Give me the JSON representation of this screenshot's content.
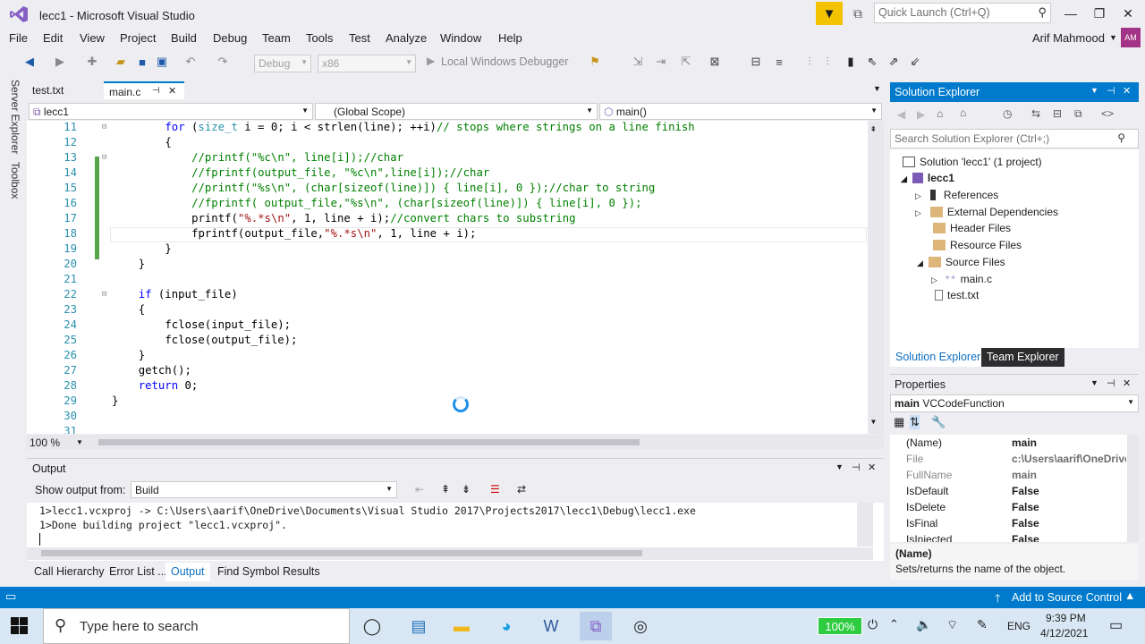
{
  "window": {
    "title": "lecc1 - Microsoft Visual Studio",
    "quick_launch_placeholder": "Quick Launch (Ctrl+Q)"
  },
  "menu": [
    "File",
    "Edit",
    "View",
    "Project",
    "Build",
    "Debug",
    "Team",
    "Tools",
    "Test",
    "Analyze",
    "Window",
    "Help"
  ],
  "user": {
    "name": "Arif Mahmood",
    "initials": "AM"
  },
  "toolbar": {
    "config": "Debug",
    "platform": "x86",
    "debugger": "Local Windows Debugger"
  },
  "editor": {
    "tabs": [
      {
        "label": "test.txt"
      },
      {
        "label": "main.c"
      }
    ],
    "nav": {
      "project": "lecc1",
      "scope": "(Global Scope)",
      "function": "main()"
    },
    "zoom": "100 %",
    "lines": [
      {
        "n": "11",
        "segments": [
          {
            "c": "kw",
            "t": "for"
          },
          {
            "c": "",
            "t": " ("
          },
          {
            "c": "ty",
            "t": "size_t"
          },
          {
            "c": "",
            "t": " i = 0; i < strlen(line); ++i)"
          },
          {
            "c": "cm",
            "t": "// stops where strings on a line finish"
          }
        ],
        "indent": 4
      },
      {
        "n": "12",
        "segments": [
          {
            "c": "",
            "t": "{"
          }
        ],
        "indent": 4
      },
      {
        "n": "13",
        "segments": [
          {
            "c": "cm",
            "t": "//printf(\"%c\\n\", line[i]);//char"
          }
        ],
        "indent": 5
      },
      {
        "n": "14",
        "segments": [
          {
            "c": "cm",
            "t": "//fprintf(output_file, \"%c\\n\",line[i]);//char"
          }
        ],
        "indent": 5
      },
      {
        "n": "15",
        "segments": [
          {
            "c": "cm",
            "t": "//printf(\"%s\\n\", (char[sizeof(line)]) { line[i], 0 });//char to string"
          }
        ],
        "indent": 5
      },
      {
        "n": "16",
        "segments": [
          {
            "c": "cm",
            "t": "//fprintf( output_file,\"%s\\n\", (char[sizeof(line)]) { line[i], 0 });"
          }
        ],
        "indent": 5
      },
      {
        "n": "17",
        "segments": [
          {
            "c": "",
            "t": "printf("
          },
          {
            "c": "st",
            "t": "\"%.*s\\n\""
          },
          {
            "c": "",
            "t": ", 1, line + i);"
          },
          {
            "c": "cm",
            "t": "//convert chars to substring"
          }
        ],
        "indent": 5
      },
      {
        "n": "18",
        "segments": [
          {
            "c": "",
            "t": "fprintf(output_file,"
          },
          {
            "c": "st",
            "t": "\"%.*s\\n\""
          },
          {
            "c": "",
            "t": ", 1, line + i);"
          }
        ],
        "indent": 5
      },
      {
        "n": "19",
        "segments": [
          {
            "c": "",
            "t": "}"
          }
        ],
        "indent": 4
      },
      {
        "n": "20",
        "segments": [
          {
            "c": "",
            "t": "}"
          }
        ],
        "indent": 3
      },
      {
        "n": "21",
        "segments": [],
        "indent": 3
      },
      {
        "n": "22",
        "segments": [
          {
            "c": "kw",
            "t": "if"
          },
          {
            "c": "",
            "t": " (input_file)"
          }
        ],
        "indent": 3
      },
      {
        "n": "23",
        "segments": [
          {
            "c": "",
            "t": "{"
          }
        ],
        "indent": 3
      },
      {
        "n": "24",
        "segments": [
          {
            "c": "",
            "t": "fclose(input_file);"
          }
        ],
        "indent": 4
      },
      {
        "n": "25",
        "segments": [
          {
            "c": "",
            "t": "fclose(output_file);"
          }
        ],
        "indent": 4
      },
      {
        "n": "26",
        "segments": [
          {
            "c": "",
            "t": "}"
          }
        ],
        "indent": 3
      },
      {
        "n": "27",
        "segments": [
          {
            "c": "",
            "t": "getch();"
          }
        ],
        "indent": 3
      },
      {
        "n": "28",
        "segments": [
          {
            "c": "kw",
            "t": "return"
          },
          {
            "c": "",
            "t": " 0;"
          }
        ],
        "indent": 3
      },
      {
        "n": "29",
        "segments": [
          {
            "c": "",
            "t": "}"
          }
        ],
        "indent": 2
      },
      {
        "n": "30",
        "segments": [],
        "indent": 2
      },
      {
        "n": "31",
        "segments": [],
        "indent": 2
      }
    ]
  },
  "side_tabs": [
    "Server Explorer",
    "Toolbox"
  ],
  "solution_explorer": {
    "title": "Solution Explorer",
    "search_placeholder": "Search Solution Explorer (Ctrl+;)",
    "tree": [
      {
        "label": "Solution 'lecc1' (1 project)",
        "icon": "solution-icon"
      },
      {
        "label": "lecc1",
        "icon": "project-icon"
      },
      {
        "label": "References",
        "icon": "references-icon"
      },
      {
        "label": "External Dependencies",
        "icon": "folder-icon"
      },
      {
        "label": "Header Files",
        "icon": "folder-icon"
      },
      {
        "label": "Resource Files",
        "icon": "folder-icon"
      },
      {
        "label": "Source Files",
        "icon": "folder-icon"
      },
      {
        "label": "main.c",
        "icon": "c-file-icon"
      },
      {
        "label": "test.txt",
        "icon": "text-file-icon"
      }
    ],
    "tabs": [
      "Solution Explorer",
      "Team Explorer"
    ]
  },
  "properties": {
    "title": "Properties",
    "object": "main",
    "object_type": "VCCodeFunction",
    "rows": [
      {
        "k": "(Name)",
        "v": "main"
      },
      {
        "k": "File",
        "v": "c:\\Users\\aarif\\OneDrive"
      },
      {
        "k": "FullName",
        "v": "main"
      },
      {
        "k": "IsDefault",
        "v": "False"
      },
      {
        "k": "IsDelete",
        "v": "False"
      },
      {
        "k": "IsFinal",
        "v": "False"
      },
      {
        "k": "IsInjected",
        "v": "False"
      }
    ],
    "desc_title": "(Name)",
    "desc_text": "Sets/returns the name of the object."
  },
  "output": {
    "title": "Output",
    "show_from_label": "Show output from:",
    "source": "Build",
    "lines": [
      "1>lecc1.vcxproj -> C:\\Users\\aarif\\OneDrive\\Documents\\Visual Studio 2017\\Projects2017\\lecc1\\Debug\\lecc1.exe",
      "1>Done building project \"lecc1.vcxproj\"."
    ]
  },
  "bottom_tabs": [
    "Call Hierarchy",
    "Error List ...",
    "Output",
    "Find Symbol Results"
  ],
  "status": {
    "source_control": "Add to Source Control"
  },
  "taskbar": {
    "search_placeholder": "Type here to search",
    "battery": "100%",
    "lang": "ENG",
    "time": "9:39 PM",
    "date": "4/12/2021"
  }
}
